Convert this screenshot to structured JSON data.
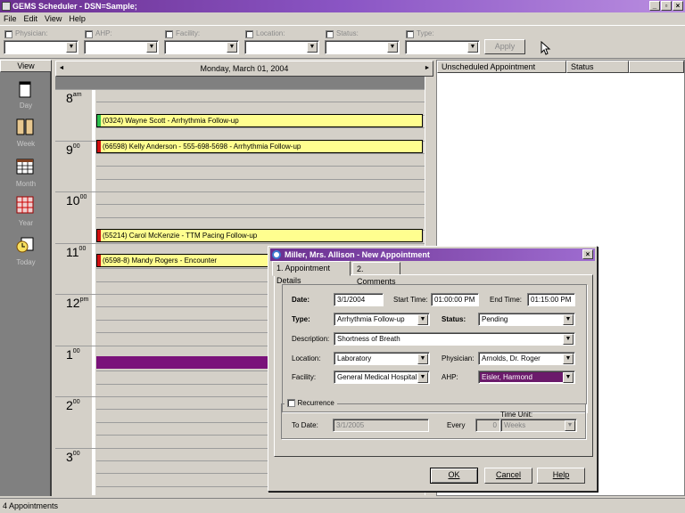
{
  "window": {
    "title": "GEMS Scheduler - DSN=Sample;"
  },
  "menu": [
    "File",
    "Edit",
    "View",
    "Help"
  ],
  "filters": {
    "items": [
      {
        "label": "Physician:"
      },
      {
        "label": "AHP:"
      },
      {
        "label": "Facility:"
      },
      {
        "label": "Location:"
      },
      {
        "label": "Status:"
      },
      {
        "label": "Type:"
      }
    ],
    "apply_label": "Apply"
  },
  "view_panel": {
    "header": "View",
    "items": [
      {
        "label": "Day",
        "icon": "day-icon"
      },
      {
        "label": "Week",
        "icon": "week-icon"
      },
      {
        "label": "Month",
        "icon": "month-icon"
      },
      {
        "label": "Year",
        "icon": "year-icon"
      },
      {
        "label": "Today",
        "icon": "today-icon"
      }
    ]
  },
  "calendar": {
    "date_header": "Monday, March 01, 2004",
    "hours": [
      {
        "h": "8",
        "s": "am"
      },
      {
        "h": "9",
        "s": "00"
      },
      {
        "h": "10",
        "s": "00"
      },
      {
        "h": "11",
        "s": "00"
      },
      {
        "h": "12",
        "s": "pm"
      },
      {
        "h": "1",
        "s": "00"
      },
      {
        "h": "2",
        "s": "00"
      },
      {
        "h": "3",
        "s": "00"
      }
    ],
    "appointments": [
      {
        "text": "(0324) Wayne Scott - Arrhythmia Follow-up",
        "color": "#2ec04e"
      },
      {
        "text": "(66598) Kelly Anderson - 555-698-5698 - Arrhythmia Follow-up",
        "color": "#d01010"
      },
      {
        "text": "(55214) Carol McKenzie - TTM Pacing Follow-up",
        "color": "#d01010"
      },
      {
        "text": "(6598-8) Mandy Rogers - Encounter",
        "color": "#d01010"
      }
    ],
    "selection_color": "#7a127a"
  },
  "right_panel": {
    "columns": [
      "Unscheduled Appointment",
      "Status"
    ]
  },
  "status_bar": {
    "text": "4 Appointments"
  },
  "dialog": {
    "title": "Miller, Mrs. Allison - New Appointment",
    "tabs": [
      "1. Appointment Details",
      "2. Comments"
    ],
    "date_label": "Date:",
    "date": "3/1/2004",
    "start_label": "Start Time:",
    "start": "01:00:00 PM",
    "end_label": "End Time:",
    "end": "01:15:00 PM",
    "type_label": "Type:",
    "type": "Arrhythmia Follow-up",
    "status_label": "Status:",
    "status": "Pending",
    "desc_label": "Description:",
    "desc": "Shortness of Breath",
    "location_label": "Location:",
    "location": "Laboratory",
    "physician_label": "Physician:",
    "physician": "Arnolds, Dr. Roger",
    "facility_label": "Facility:",
    "facility": "General Medical Hospital",
    "ahp_label": "AHP:",
    "ahp": "Eisler, Harmond",
    "recurrence_label": "Recurrence",
    "todate_label": "To Date:",
    "todate": "3/1/2005",
    "every_label": "Every",
    "every": "0",
    "timeunit_label": "Time Unit:",
    "timeunit": "Weeks",
    "ok": "OK",
    "cancel": "Cancel",
    "help": "Help"
  }
}
